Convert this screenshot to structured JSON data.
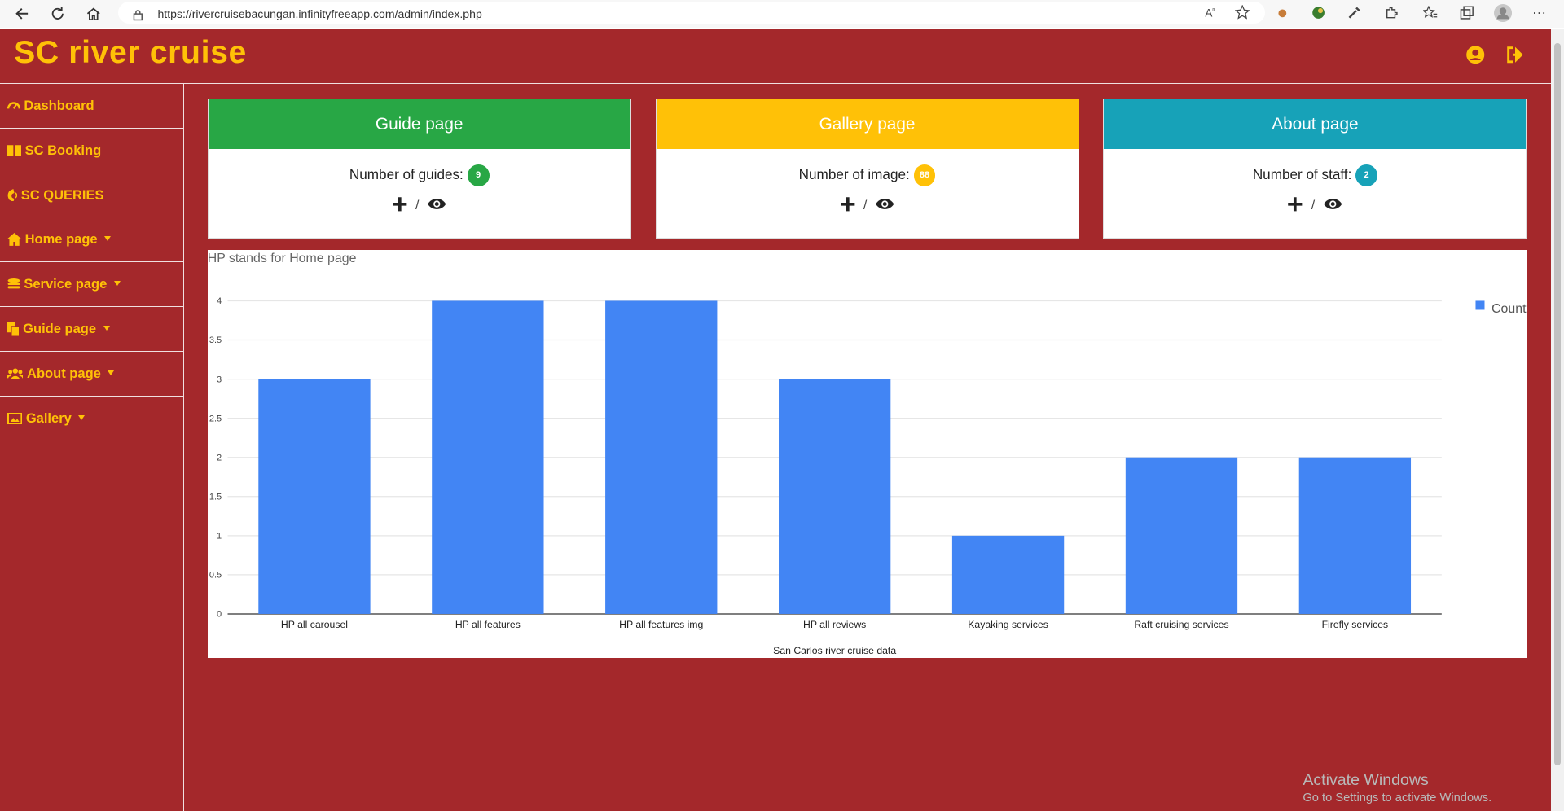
{
  "browser": {
    "url": "https://rivercruisebacungan.infinityfreeapp.com/admin/index.php"
  },
  "brand": {
    "title": "SC river cruise"
  },
  "sidebar": {
    "items": [
      {
        "label": "Dashboard",
        "icon": "tachometer-icon",
        "dropdown": false
      },
      {
        "label": "SC Booking",
        "icon": "book-icon",
        "dropdown": false
      },
      {
        "label": "SC QUERIES",
        "icon": "phone-icon",
        "dropdown": false
      },
      {
        "label": "Home page",
        "icon": "home-icon",
        "dropdown": true
      },
      {
        "label": "Service page",
        "icon": "coins-icon",
        "dropdown": true
      },
      {
        "label": "Guide page",
        "icon": "copy-icon",
        "dropdown": true
      },
      {
        "label": "About page",
        "icon": "users-icon",
        "dropdown": true
      },
      {
        "label": "Gallery",
        "icon": "images-icon",
        "dropdown": true
      }
    ]
  },
  "cards": [
    {
      "title": "Guide page",
      "count_label": "Number of guides:",
      "count": "9",
      "color": "#28a745",
      "separator": "/"
    },
    {
      "title": "Gallery page",
      "count_label": "Number of image:",
      "count": "88",
      "color": "#ffc107",
      "separator": "/"
    },
    {
      "title": "About page",
      "count_label": "Number of staff:",
      "count": "2",
      "color": "#17a2b8",
      "separator": "/"
    }
  ],
  "chart_data": {
    "type": "bar",
    "title": "HP stands for Home page",
    "xlabel": "San Carlos river cruise data",
    "ylabel": "",
    "categories": [
      "HP all carousel",
      "HP all features",
      "HP all features img",
      "HP all reviews",
      "Kayaking services",
      "Raft cruising services",
      "Firefly services"
    ],
    "series": [
      {
        "name": "Count",
        "values": [
          3,
          4,
          4,
          3,
          1,
          2,
          2
        ],
        "color": "#4285f4"
      }
    ],
    "ylim": [
      0,
      4
    ],
    "yticks": [
      "0",
      "0.5",
      "1",
      "1.5",
      "2",
      "2.5",
      "3",
      "3.5",
      "4"
    ],
    "grid": true,
    "legend": "right"
  },
  "watermark": {
    "line1": "Activate Windows",
    "line2": "Go to Settings to activate Windows."
  },
  "colors": {
    "background": "#a4282b",
    "accent": "#ffc107"
  }
}
